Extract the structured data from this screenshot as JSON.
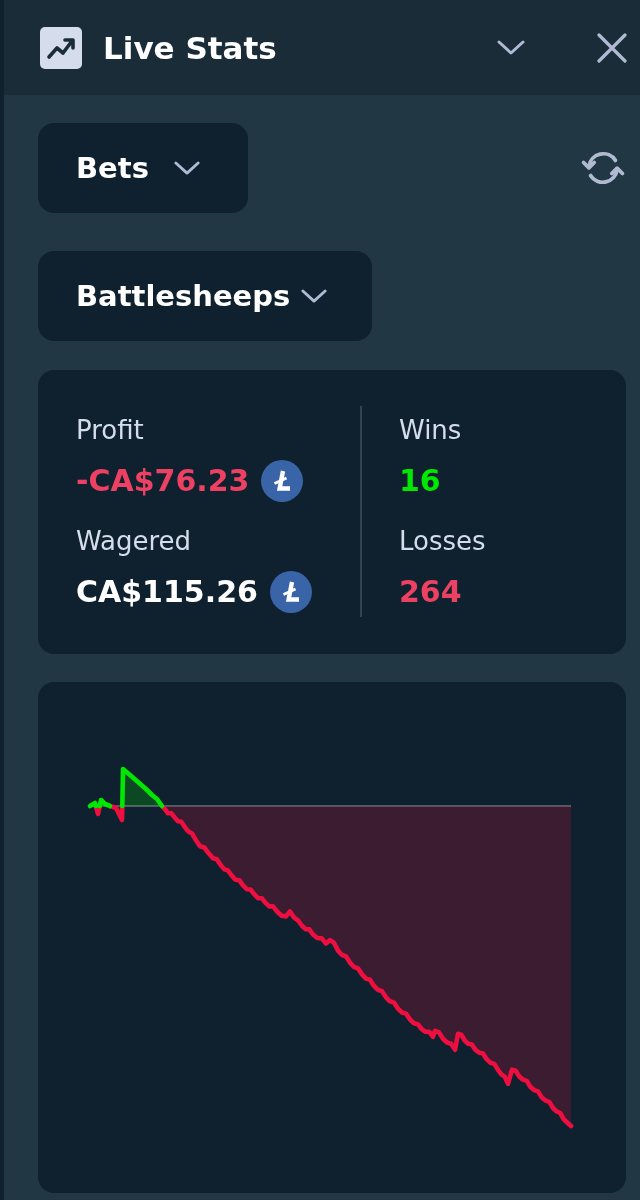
{
  "header": {
    "title": "Live Stats"
  },
  "filters": [
    {
      "label": "Bets"
    },
    {
      "label": "Battlesheeps"
    }
  ],
  "stats": {
    "columns": [
      [
        {
          "label": "Profit",
          "value": "-CA$76.23",
          "color": "#ed4163",
          "coin": true
        },
        {
          "label": "Wagered",
          "value": "CA$115.26",
          "color": "#ffffff",
          "coin": true
        }
      ],
      [
        {
          "label": "Wins",
          "value": "16",
          "color": "#00e701",
          "coin": false
        },
        {
          "label": "Losses",
          "value": "264",
          "color": "#ed4163",
          "coin": false
        }
      ]
    ]
  }
}
